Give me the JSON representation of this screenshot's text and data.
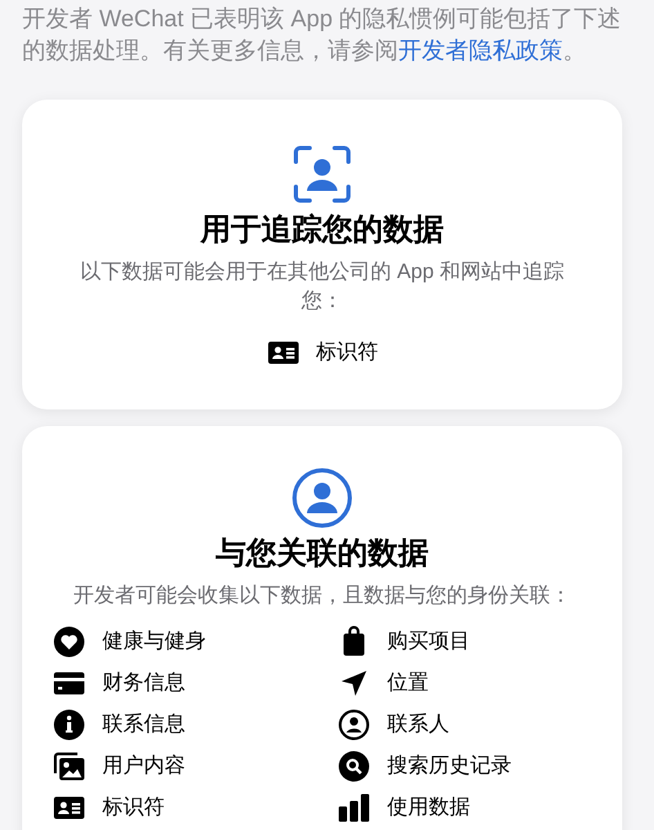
{
  "intro": {
    "text": "开发者 WeChat 已表明该 App 的隐私惯例可能包括了下述的数据处理。有关更多信息，请参阅",
    "link": "开发者隐私政策",
    "end": "。"
  },
  "tracking_card": {
    "title": "用于追踪您的数据",
    "subtitle": "以下数据可能会用于在其他公司的 App 和网站中追踪您：",
    "items": [
      {
        "label": "标识符"
      }
    ]
  },
  "linked_card": {
    "title": "与您关联的数据",
    "subtitle": "开发者可能会收集以下数据，且数据与您的身份关联：",
    "items": [
      {
        "label": "健康与健身"
      },
      {
        "label": "购买项目"
      },
      {
        "label": "财务信息"
      },
      {
        "label": "位置"
      },
      {
        "label": "联系信息"
      },
      {
        "label": "联系人"
      },
      {
        "label": "用户内容"
      },
      {
        "label": "搜索历史记录"
      },
      {
        "label": "标识符"
      },
      {
        "label": "使用数据"
      }
    ]
  }
}
